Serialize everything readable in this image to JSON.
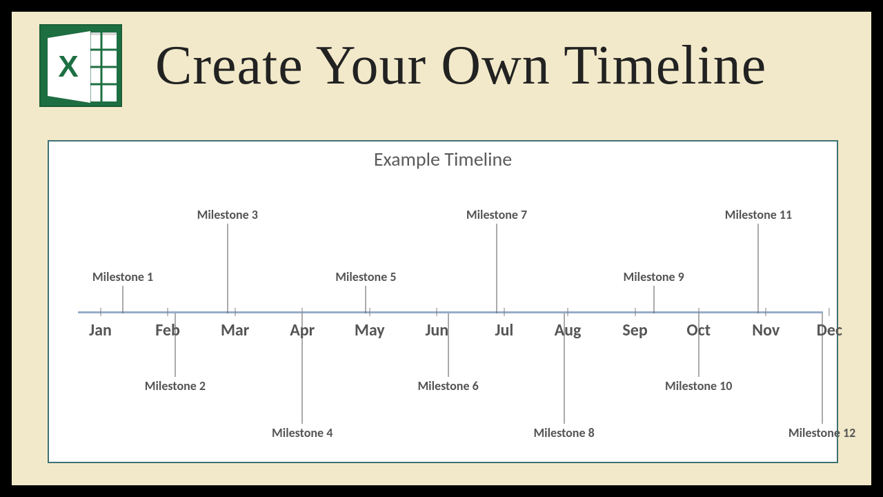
{
  "header": {
    "title": "Create Your Own Timeline",
    "icon_letter": "X"
  },
  "chart": {
    "title": "Example Timeline"
  },
  "chart_data": {
    "type": "timeline",
    "title": "Example Timeline",
    "xlabel": "",
    "ylabel": "",
    "categories": [
      "Jan",
      "Feb",
      "Mar",
      "Apr",
      "May",
      "Jun",
      "Jul",
      "Aug",
      "Sep",
      "Oct",
      "Nov",
      "Dec"
    ],
    "milestones": [
      {
        "label": "Milestone 1",
        "month": "Jan",
        "x": 0.06,
        "position": "above",
        "height": 40
      },
      {
        "label": "Milestone 2",
        "month": "Feb",
        "x": 0.13,
        "position": "below",
        "height": 92
      },
      {
        "label": "Milestone 3",
        "month": "Mar",
        "x": 0.2,
        "position": "above",
        "height": 130
      },
      {
        "label": "Milestone 4",
        "month": "Apr",
        "x": 0.3,
        "position": "below",
        "height": 160
      },
      {
        "label": "Milestone 5",
        "month": "May",
        "x": 0.385,
        "position": "above",
        "height": 40
      },
      {
        "label": "Milestone 6",
        "month": "Jun",
        "x": 0.495,
        "position": "below",
        "height": 92
      },
      {
        "label": "Milestone 7",
        "month": "Jul",
        "x": 0.56,
        "position": "above",
        "height": 130
      },
      {
        "label": "Milestone 8",
        "month": "Aug",
        "x": 0.65,
        "position": "below",
        "height": 160
      },
      {
        "label": "Milestone 9",
        "month": "Sep",
        "x": 0.77,
        "position": "above",
        "height": 40
      },
      {
        "label": "Milestone 10",
        "month": "Oct",
        "x": 0.83,
        "position": "below",
        "height": 92
      },
      {
        "label": "Milestone 11",
        "month": "Nov",
        "x": 0.91,
        "position": "above",
        "height": 130
      },
      {
        "label": "Milestone 12",
        "month": "Dec",
        "x": 0.995,
        "position": "below",
        "height": 160
      }
    ],
    "tick_positions": [
      0.03,
      0.12,
      0.21,
      0.3,
      0.39,
      0.48,
      0.57,
      0.655,
      0.745,
      0.83,
      0.92,
      1.005
    ]
  }
}
